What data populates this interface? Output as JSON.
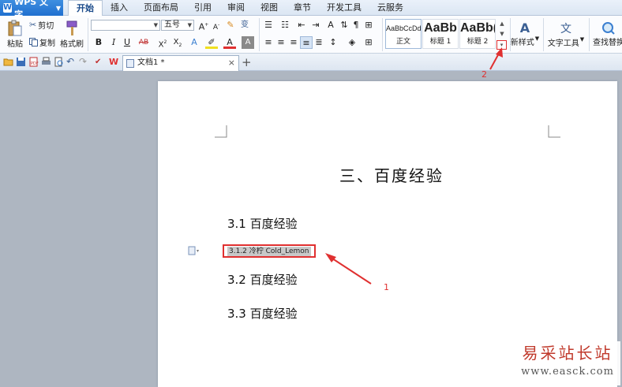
{
  "app": {
    "name": "WPS 文字"
  },
  "menu": {
    "tabs": [
      "开始",
      "插入",
      "页面布局",
      "引用",
      "审阅",
      "视图",
      "章节",
      "开发工具",
      "云服务"
    ],
    "active": "开始"
  },
  "ribbon": {
    "paste": "粘贴",
    "cut": "剪切",
    "copy": "复制",
    "format_painter": "格式刷",
    "font_name": "",
    "font_size": "五号",
    "styles": [
      {
        "preview": "AaBbCcDd",
        "label": "正文"
      },
      {
        "preview": "AaBb",
        "label": "标题 1"
      },
      {
        "preview": "AaBb(",
        "label": "标题 2"
      }
    ],
    "new_style": "新样式",
    "text_tools": "文字工具",
    "find_replace": "查找替换"
  },
  "document_tab": {
    "name": "文档1 *"
  },
  "document": {
    "title": "三、百度经验",
    "headings": [
      "3.1 百度经验",
      "3.2 百度经验",
      "3.3 百度经验"
    ],
    "selected_line": "3.1.2 冷柠 Cold_Lemon"
  },
  "annotations": {
    "one": "1",
    "two": "2"
  },
  "watermark": {
    "line1": "易采站长站",
    "line2": "www.easck.com"
  },
  "colors": {
    "accent": "#1f6fcf",
    "annotation": "#e03030"
  }
}
